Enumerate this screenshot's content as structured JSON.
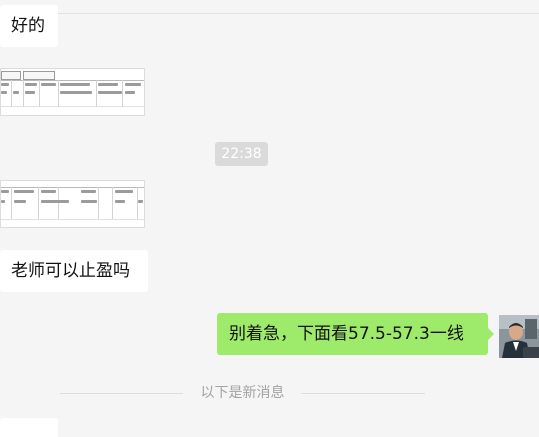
{
  "messages": {
    "msg1_text": "好的",
    "timestamp": "22:38",
    "msg4_text": "老师可以止盈吗",
    "msg5_text": "别着急，下面看57.5-57.3一线",
    "new_messages_divider": "以下是新消息"
  },
  "colors": {
    "sent_bubble": "#9eea6a",
    "received_bubble": "#ffffff",
    "background": "#f5f5f5"
  }
}
